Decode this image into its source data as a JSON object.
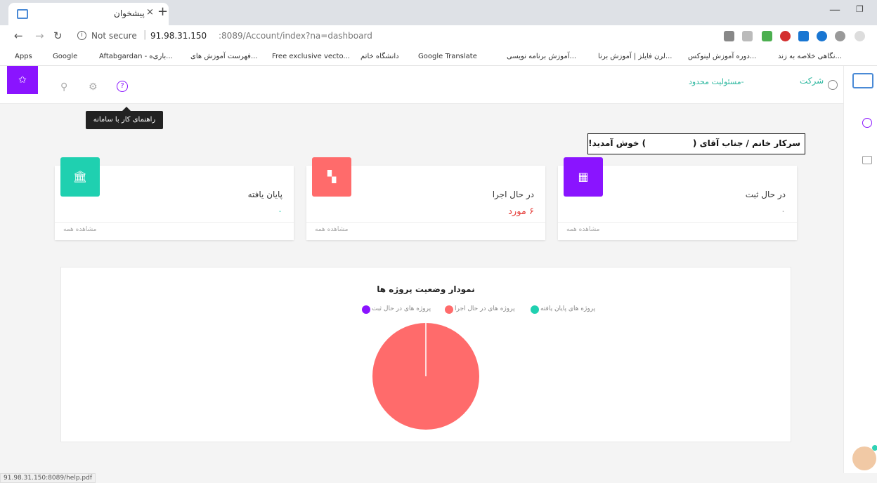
{
  "browser": {
    "tab_title": "پیشخوان",
    "tab_close": "×",
    "new_tab": "+",
    "not_secure": "Not secure",
    "url_host": "91.98.31.150",
    "url_path": ":8089/Account/index?na=dashboard",
    "status_url": "91.98.31.150:8089/help.pdf"
  },
  "bookmarks": [
    {
      "label": "Apps",
      "color": "#4a8ad6"
    },
    {
      "label": "Google",
      "color": "#4285f4"
    },
    {
      "label": "Aftabgardan - باری‌ه...",
      "color": "#f0a000"
    },
    {
      "label": "فهرست آموزش های...",
      "color": "#8bc34a"
    },
    {
      "label": "Free exclusive vecto...",
      "color": "#2a7bd3"
    },
    {
      "label": "دانشگاه خاتم",
      "color": "#555555"
    },
    {
      "label": "Google Translate",
      "color": "#4285f4"
    },
    {
      "label": "آموزش برنامه نویسی...",
      "color": "#cccccc"
    },
    {
      "label": "لرن فایلز | آموزش برنا...",
      "color": "#e95b2b"
    },
    {
      "label": "دوره آموزش لینوکس...",
      "color": "#e95b2b"
    },
    {
      "label": "نگاهی خلاصه به زند...",
      "color": "#1e6fd9"
    }
  ],
  "header": {
    "user_icon": "user-plus-icon",
    "company_label": "شرکت",
    "company_suffix": "-مسئولیت محدود",
    "help_tooltip": "راهنمای کار با سامانه"
  },
  "welcome": "سرکار خانم / جناب آقای (                ) خوش آمدید!",
  "cards": [
    {
      "title": "در حال ثبت",
      "value": "۰",
      "value_color": "#aaaaaa",
      "link": "مشاهده همه",
      "icon_color": "#8a14ff",
      "icon": "building-icon"
    },
    {
      "title": "در حال اجرا",
      "value": "۶ مورد",
      "value_color": "#e53935",
      "link": "مشاهده همه",
      "icon_color": "#ff6b6b",
      "icon": "widgets-icon"
    },
    {
      "title": "پایان یافته",
      "value": "۰",
      "value_color": "#2fd2b5",
      "link": "مشاهده همه",
      "icon_color": "#1fd0b0",
      "icon": "bank-icon"
    }
  ],
  "chart_data": {
    "type": "pie",
    "title": "نمودار وضعیت پروژه ها",
    "legend_position": "top",
    "categories": [
      "پروژه های پایان یافته",
      "پروژه های در حال اجرا",
      "پروژه های در حال ثبت"
    ],
    "values": [
      0,
      6,
      0
    ],
    "colors": [
      "#1fd0b0",
      "#ff6b6b",
      "#8a14ff"
    ]
  }
}
